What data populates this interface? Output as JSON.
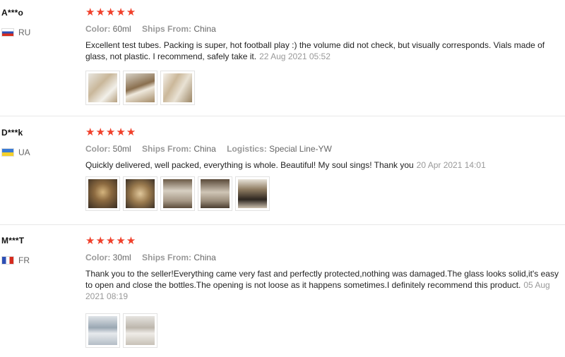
{
  "reviews": [
    {
      "user": "A***o",
      "country": "RU",
      "stars": "★★★★★",
      "meta": [
        {
          "key": "Color:",
          "value": "60ml"
        },
        {
          "key": "Ships From:",
          "value": "China"
        }
      ],
      "text": "Excellent test tubes. Packing is super, hot football play :) the volume did not check, but visually corresponds. Vials made of glass, not plastic. I recommend, safely take it.",
      "date": "22 Aug 2021 05:52",
      "thumbs": 3
    },
    {
      "user": "D***k",
      "country": "UA",
      "stars": "★★★★★",
      "meta": [
        {
          "key": "Color:",
          "value": "50ml"
        },
        {
          "key": "Ships From:",
          "value": "China"
        },
        {
          "key": "Logistics:",
          "value": "Special Line-YW"
        }
      ],
      "text": "Quickly delivered, well packed, everything is whole. Beautiful! My soul sings! Thank you",
      "date": "20 Apr 2021 14:01",
      "thumbs": 5
    },
    {
      "user": "M***T",
      "country": "FR",
      "stars": "★★★★★",
      "meta": [
        {
          "key": "Color:",
          "value": "30ml"
        },
        {
          "key": "Ships From:",
          "value": "China"
        }
      ],
      "text": "Thank you to the seller!Everything came very fast and perfectly protected,nothing was damaged.The glass looks solid,it's easy to open and close the bottles.The opening is not loose as it happens sometimes.I definitely recommend this product.",
      "date": "05 Aug 2021 08:19",
      "thumbs": 2
    }
  ]
}
